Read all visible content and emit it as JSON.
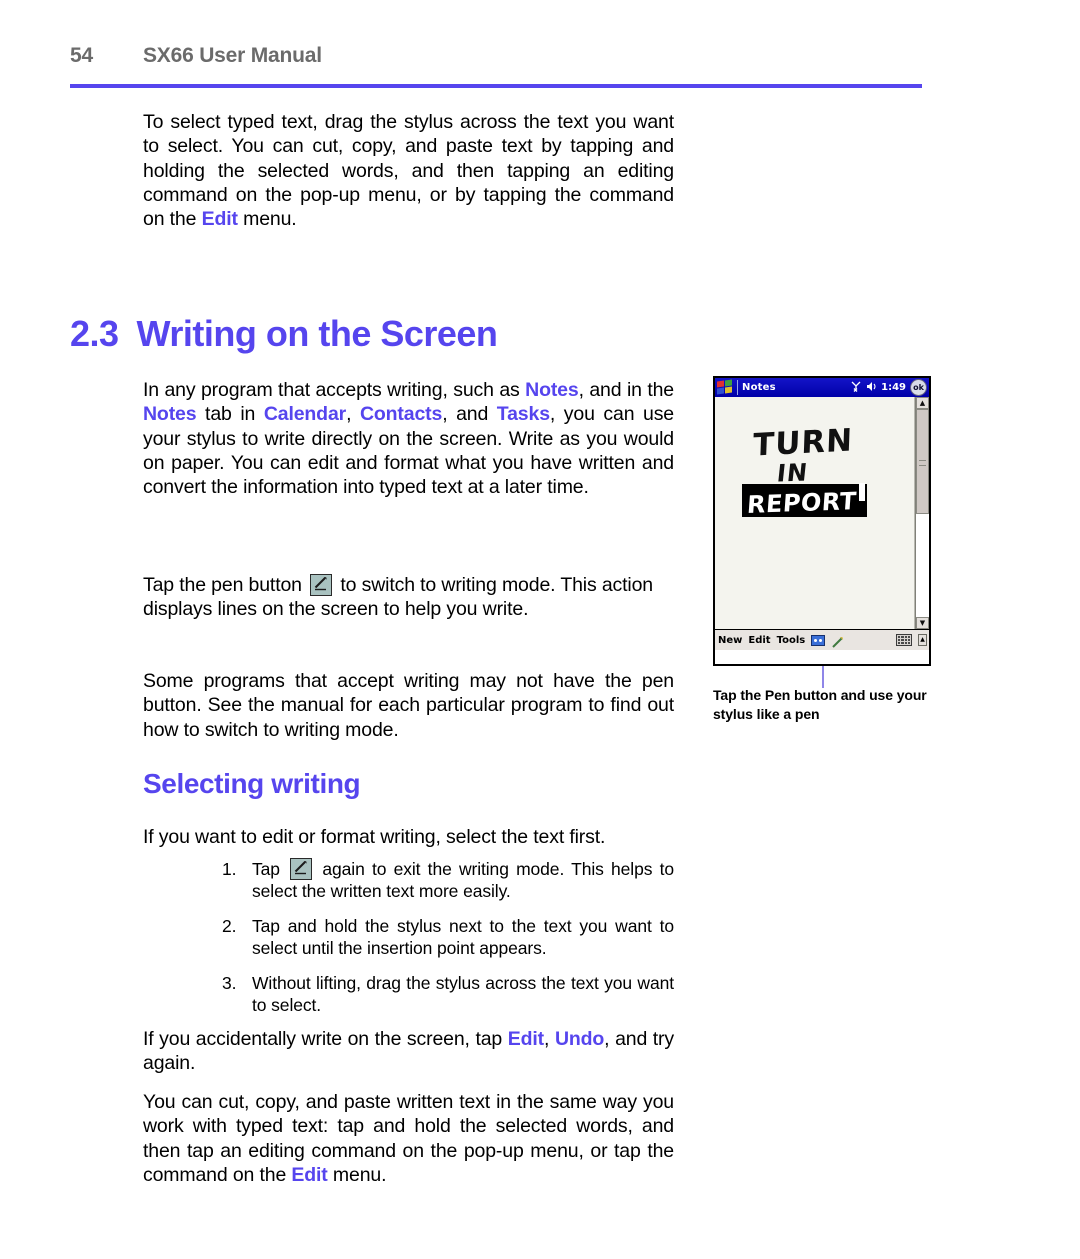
{
  "header": {
    "page_number": "54",
    "document_title": "SX66 User Manual",
    "rule_color": "#5645ee"
  },
  "intro_paragraph": {
    "part1": "To select typed text, drag the stylus across the text you want to select. You can cut, copy, and paste text by tapping and holding the selected words, and then tapping an editing command on the pop-up menu, or by tapping the command on the ",
    "highlight": "Edit",
    "part2": " menu."
  },
  "section": {
    "number": "2.3",
    "title": "Writing on the Screen",
    "color": "#5645ee"
  },
  "paragraph_writing": {
    "p1": "In any program that accepts writing, such as ",
    "hl1": "Notes",
    "p2": ", and in the ",
    "hl2": "Notes",
    "p3": " tab in ",
    "hl3": "Calendar",
    "p4": ", ",
    "hl4": "Contacts",
    "p5": ", and ",
    "hl5": "Tasks",
    "p6": ", you can use your stylus to write directly on the screen. Write as you would on paper. You can edit and format what you have written and convert the information into typed text at a later time."
  },
  "paragraph_pen": {
    "p1": "Tap the pen button ",
    "p2": " to switch to writing mode. This action displays lines on the screen to help you write."
  },
  "paragraph_nopen": {
    "text": "Some programs that accept writing may not have the pen button. See the manual for each particular program to find out how to switch to writing mode."
  },
  "subsection": {
    "title": "Selecting writing",
    "color": "#5645ee"
  },
  "paragraph_selecting": {
    "text": "If you want to edit or format writing, select the text first."
  },
  "steps": [
    {
      "marker": "1.",
      "pre": "Tap ",
      "post": " again to exit the writing mode. This helps to select the written text more easily.",
      "has_icon": true
    },
    {
      "marker": "2.",
      "pre": "Tap and hold the stylus next to the text you want to select until the insertion point appears.",
      "post": "",
      "has_icon": false
    },
    {
      "marker": "3.",
      "pre": "Without lifting, drag the stylus across the text you want to select.",
      "post": "",
      "has_icon": false
    }
  ],
  "paragraph_undo": {
    "p1": "If you accidentally write on the screen, tap ",
    "hl1": "Edit",
    "p2": ", ",
    "hl2": "Undo",
    "p3": ", and try again."
  },
  "paragraph_cutcopy": {
    "p1": "You can cut, copy, and paste written text in the same way you work with typed text: tap and hold the selected words, and then tap an editing command on the pop-up menu, or tap the command on the ",
    "hl1": "Edit",
    "p2": " menu."
  },
  "device": {
    "titlebar": {
      "app_name": "Notes",
      "signal_icon": "antenna-off-icon",
      "speaker_icon": "speaker-icon",
      "time": "1:49",
      "ok_label": "ok",
      "background_color": "#0000c8"
    },
    "note": {
      "line1": "TURN",
      "line2": "IN",
      "line3": "REPORT",
      "line3_selected": true
    },
    "commandbar": {
      "new_label": "New",
      "edit_label": "Edit",
      "tools_label": "Tools",
      "record_icon": "record-icon",
      "pen_icon": "pen-icon",
      "keyboard_icon": "keyboard-icon",
      "keyboard_arrow": "▲"
    },
    "scrollbar": {
      "up_arrow": "▲",
      "down_arrow": "▼"
    }
  },
  "caption": {
    "text": "Tap the Pen button and use your stylus like a pen"
  },
  "icons": {
    "pen_button": "pen-button-icon"
  }
}
